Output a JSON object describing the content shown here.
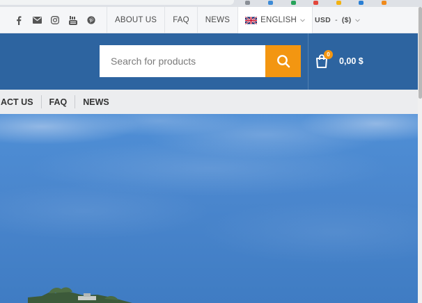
{
  "topbar": {
    "social": [
      {
        "icon": "facebook-icon"
      },
      {
        "icon": "mail-icon"
      },
      {
        "icon": "instagram-icon"
      },
      {
        "icon": "youtube-icon"
      },
      {
        "icon": "pinterest-icon"
      }
    ],
    "links": [
      "ABOUT US",
      "FAQ",
      "NEWS"
    ],
    "language": {
      "label": "ENGLISH",
      "flag_icon": "uk-flag-icon"
    },
    "currency": {
      "code": "USD",
      "symbol": "($)"
    }
  },
  "header": {
    "search_placeholder": "Search for products",
    "cart": {
      "count": "0",
      "total": "0,00 $"
    },
    "colors": {
      "header_bg": "#2d64a0",
      "accent": "#f39611"
    }
  },
  "nav": {
    "links": [
      "ACT US",
      "FAQ",
      "NEWS"
    ]
  }
}
